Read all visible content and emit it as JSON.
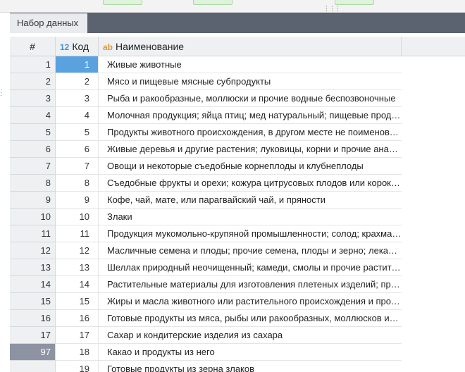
{
  "tab": {
    "label": "Набор данных"
  },
  "columns": {
    "num": "#",
    "code_badge": "12",
    "code": "Код",
    "name_badge": "ab",
    "name": "Наименование"
  },
  "rows": [
    {
      "rn": "1",
      "code": "1",
      "name": "Живые животные"
    },
    {
      "rn": "2",
      "code": "2",
      "name": "Мясо и пищевые мясные субпродукты"
    },
    {
      "rn": "3",
      "code": "3",
      "name": "Рыба и ракообразные, моллюски и прочие водные беспозвоночные"
    },
    {
      "rn": "4",
      "code": "4",
      "name": "Молочная продукция; яйца птиц; мед натуральный; пищевые продукты животного происхождения"
    },
    {
      "rn": "5",
      "code": "5",
      "name": "Продукты животного происхождения, в другом месте не поименованные"
    },
    {
      "rn": "6",
      "code": "6",
      "name": "Живые деревья и другие растения; луковицы, корни и прочие аналогичные части растений"
    },
    {
      "rn": "7",
      "code": "7",
      "name": "Овощи и некоторые съедобные корнеплоды и клубнеплоды"
    },
    {
      "rn": "8",
      "code": "8",
      "name": "Съедобные фрукты и орехи; кожура цитрусовых плодов или корок дынь"
    },
    {
      "rn": "9",
      "code": "9",
      "name": "Кофе, чай, мате, или парагвайский чай, и пряности"
    },
    {
      "rn": "10",
      "code": "10",
      "name": "Злаки"
    },
    {
      "rn": "11",
      "code": "11",
      "name": "Продукция мукомольно-крупяной промышленности; солод; крахмалы"
    },
    {
      "rn": "12",
      "code": "12",
      "name": "Масличные семена и плоды; прочие семена, плоды и зерно; лекарственные растения"
    },
    {
      "rn": "13",
      "code": "13",
      "name": "Шеллак природный неочищенный; камеди, смолы и прочие растительные соки"
    },
    {
      "rn": "14",
      "code": "14",
      "name": "Растительные материалы для изготовления плетеных изделий; прочие продукты"
    },
    {
      "rn": "15",
      "code": "15",
      "name": "Жиры и масла животного или растительного происхождения и продукты их расщепления"
    },
    {
      "rn": "16",
      "code": "16",
      "name": "Готовые продукты из мяса, рыбы или ракообразных, моллюсков или прочих водных беспозвоночных"
    },
    {
      "rn": "17",
      "code": "17",
      "name": "Сахар и кондитерские изделия из сахара"
    },
    {
      "rn": "97",
      "code": "18",
      "name": "Какао и продукты из него"
    },
    {
      "rn": "",
      "code": "19",
      "name": "Готовые продукты из зерна злаков"
    }
  ]
}
